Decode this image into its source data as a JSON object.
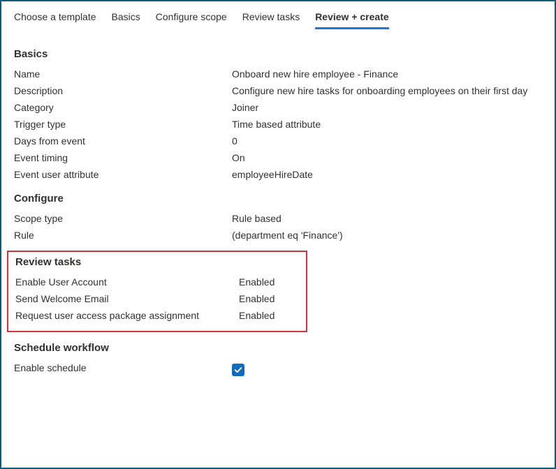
{
  "tabs": [
    {
      "label": "Choose a template"
    },
    {
      "label": "Basics"
    },
    {
      "label": "Configure scope"
    },
    {
      "label": "Review tasks"
    },
    {
      "label": "Review + create"
    }
  ],
  "activeTabIndex": 4,
  "sections": {
    "basics": {
      "heading": "Basics",
      "rows": [
        {
          "label": "Name",
          "value": "Onboard new hire employee - Finance"
        },
        {
          "label": "Description",
          "value": "Configure new hire tasks for onboarding employees on their first day"
        },
        {
          "label": "Category",
          "value": "Joiner"
        },
        {
          "label": "Trigger type",
          "value": "Time based attribute"
        },
        {
          "label": "Days from event",
          "value": "0"
        },
        {
          "label": "Event timing",
          "value": "On"
        },
        {
          "label": "Event user attribute",
          "value": "employeeHireDate"
        }
      ]
    },
    "configure": {
      "heading": "Configure",
      "rows": [
        {
          "label": "Scope type",
          "value": "Rule based"
        },
        {
          "label": "Rule",
          "value": " (department eq 'Finance')"
        }
      ]
    },
    "reviewTasks": {
      "heading": "Review tasks",
      "rows": [
        {
          "label": "Enable User Account",
          "value": "Enabled"
        },
        {
          "label": "Send Welcome Email",
          "value": "Enabled"
        },
        {
          "label": "Request user access package assignment",
          "value": "Enabled"
        }
      ]
    },
    "schedule": {
      "heading": "Schedule workflow",
      "enableLabel": "Enable schedule",
      "enabled": true
    }
  }
}
